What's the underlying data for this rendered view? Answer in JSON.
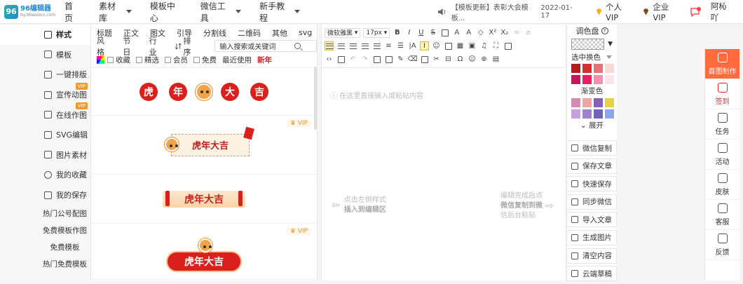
{
  "logo": {
    "mark": "96",
    "name": "96编辑器",
    "url": "by.96weixin.com"
  },
  "nav": [
    "首页",
    "素材库",
    "模板中心",
    "微信工具",
    "新手教程"
  ],
  "notice": {
    "text": "【模板更新】表彰大会模板...",
    "date": "2022-01-17"
  },
  "top_right": {
    "vip": "个人VIP",
    "corp_vip": "企业VIP",
    "user": "阿杺吖"
  },
  "left_nav": {
    "items": [
      {
        "label": "样式",
        "icon": "style-icon"
      },
      {
        "label": "模板",
        "icon": "template-icon"
      },
      {
        "label": "一键排版",
        "icon": "format-icon"
      },
      {
        "label": "宣传动图",
        "icon": "gif-icon",
        "vip": "VIP"
      },
      {
        "label": "在线作图",
        "icon": "draw-icon",
        "vip": "VIP"
      },
      {
        "label": "SVG编辑",
        "icon": "svg-icon"
      },
      {
        "label": "图片素材",
        "icon": "image-icon"
      },
      {
        "label": "我的收藏",
        "icon": "heart-icon"
      },
      {
        "label": "我的保存",
        "icon": "save-icon"
      }
    ],
    "subs": [
      "热门公号配图",
      "免费模板作图",
      "免费模板",
      "热门免费模板"
    ]
  },
  "panel": {
    "cats_row1": [
      "标题",
      "正文",
      "图文",
      "引导",
      "分割线",
      "二维码",
      "其他",
      "svg"
    ],
    "cats_row2": [
      "风格",
      "节日",
      "行业"
    ],
    "sort_label": "排序",
    "search_placeholder": "输入搜索或关键词",
    "filters": {
      "collect": "收藏",
      "select": "精选",
      "member": "会员",
      "free": "免费",
      "recent": "最近使用",
      "new": "新年"
    },
    "vip_badge": "VIP",
    "tpl1": [
      "虎",
      "年",
      "大",
      "吉"
    ],
    "tpl_text": "虎年大吉"
  },
  "editor": {
    "font": "微软雅黑",
    "size": "17px",
    "placeholder": "在这里直接输入或粘贴内容",
    "hint_left_1": "点击左侧样式",
    "hint_left_2": "插入到编辑区",
    "hint_right_1": "编辑完成后点",
    "hint_right_2": "微信复制到微",
    "hint_right_3": "信后台粘贴"
  },
  "palette": {
    "title": "调色盘",
    "select_label": "选中换色",
    "gradient_label": "渐变色",
    "expand_label": "展开",
    "solid": [
      "#b71c1c",
      "#d32f2f",
      "#e57373",
      "#f8d7d5",
      "#c2185b",
      "#e91e63",
      "#f48fb1",
      "#fce4ec"
    ],
    "gradient": [
      "#d88bb0",
      "#f1a5a0",
      "#8a5fb8",
      "#e6d24a",
      "#c8a0e0",
      "#a080d0",
      "#7060c0",
      "#8aa8e8"
    ]
  },
  "tools": [
    "微信复制",
    "保存文章",
    "快速保存",
    "同步微信",
    "导入文章",
    "生成图片",
    "清空内容",
    "云端草稿"
  ],
  "right_bar": [
    {
      "label": "首图制作",
      "icon": "cover-icon"
    },
    {
      "label": "签到",
      "icon": "calendar-icon"
    },
    {
      "label": "任务",
      "icon": "task-icon"
    },
    {
      "label": "活动",
      "icon": "gift-icon"
    },
    {
      "label": "皮肤",
      "icon": "shirt-icon"
    },
    {
      "label": "客服",
      "icon": "headset-icon"
    },
    {
      "label": "反馈",
      "icon": "feedback-icon"
    }
  ]
}
